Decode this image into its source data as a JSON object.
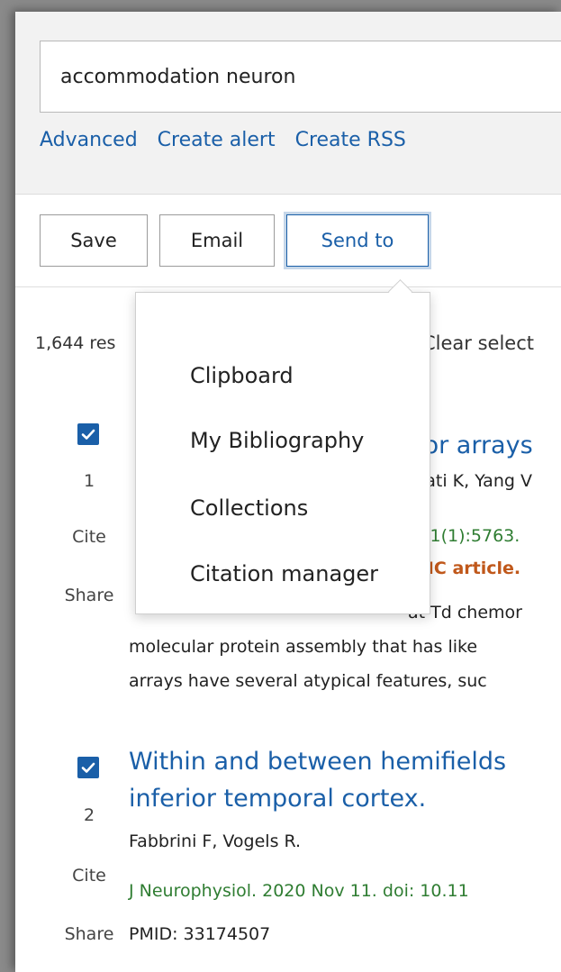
{
  "search": {
    "value": "accommodation neuron",
    "links": [
      "Advanced",
      "Create alert",
      "Create RSS"
    ]
  },
  "toolbar": {
    "save_label": "Save",
    "email_label": "Email",
    "send_label": "Send to"
  },
  "results": {
    "count_text": "1,644 res",
    "clear_text": "Clear select"
  },
  "dropdown": {
    "items": [
      "Clipboard",
      "My Bibliography",
      "Collections",
      "Citation manager"
    ]
  },
  "result1": {
    "number": "1",
    "cite": "Cite",
    "share": "Share",
    "title": "tor arrays",
    "authors": "yati K, Yang V",
    "citation": ";11(1):5763.",
    "free": "MC article.",
    "snippet": [
      "at Td chemor",
      "molecular protein assembly that has like",
      "arrays have several atypical features, suc"
    ]
  },
  "result2": {
    "number": "2",
    "cite": "Cite",
    "share": "Share",
    "title_line1": "Within and between hemifields",
    "title_line2": "inferior temporal cortex.",
    "authors": "Fabbrini F, Vogels R.",
    "citation": "J Neurophysiol. 2020 Nov 11. doi: 10.11",
    "pmid": "PMID: 33174507"
  },
  "colors": {
    "link": "#1a5fa8",
    "checkbox": "#1a5fa8",
    "citation": "#2f7d32",
    "free_article": "#c0581b"
  }
}
